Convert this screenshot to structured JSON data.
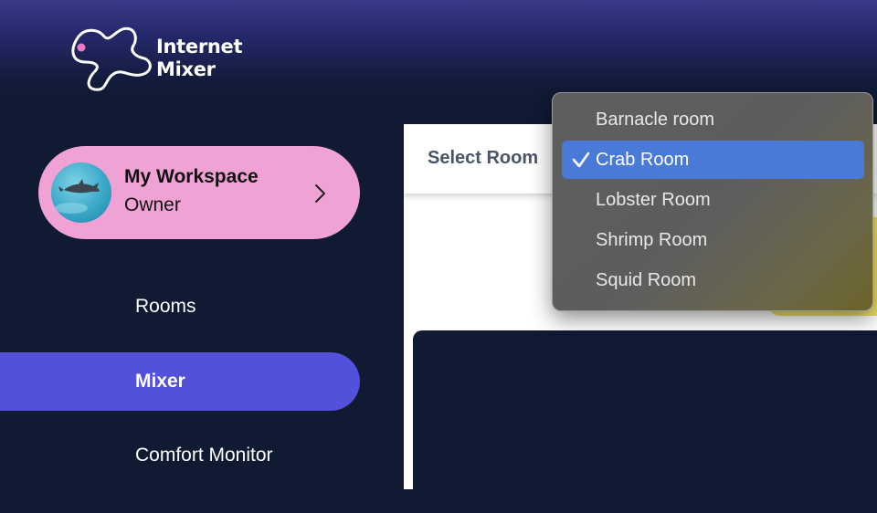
{
  "app": {
    "name_line1": "Internet",
    "name_line2": "Mixer"
  },
  "workspace": {
    "name": "My Workspace",
    "role": "Owner",
    "chevron_icon": "chevron-right-icon"
  },
  "nav": {
    "items": [
      {
        "label": "Rooms",
        "active": false
      },
      {
        "label": "Mixer",
        "active": true
      },
      {
        "label": "Comfort Monitor",
        "active": false
      }
    ]
  },
  "main": {
    "select_room_label": "Select Room"
  },
  "room_dropdown": {
    "selected": "Crab Room",
    "options": [
      {
        "label": "Barnacle room"
      },
      {
        "label": "Crab Room",
        "checked": true
      },
      {
        "label": "Lobster Room"
      },
      {
        "label": "Shrimp Room"
      },
      {
        "label": "Squid Room"
      }
    ]
  },
  "colors": {
    "sidebar_bg": "#101a33",
    "accent": "#5350dc",
    "workspace_card": "#f0a2d4",
    "selection": "#4a7ad8"
  }
}
